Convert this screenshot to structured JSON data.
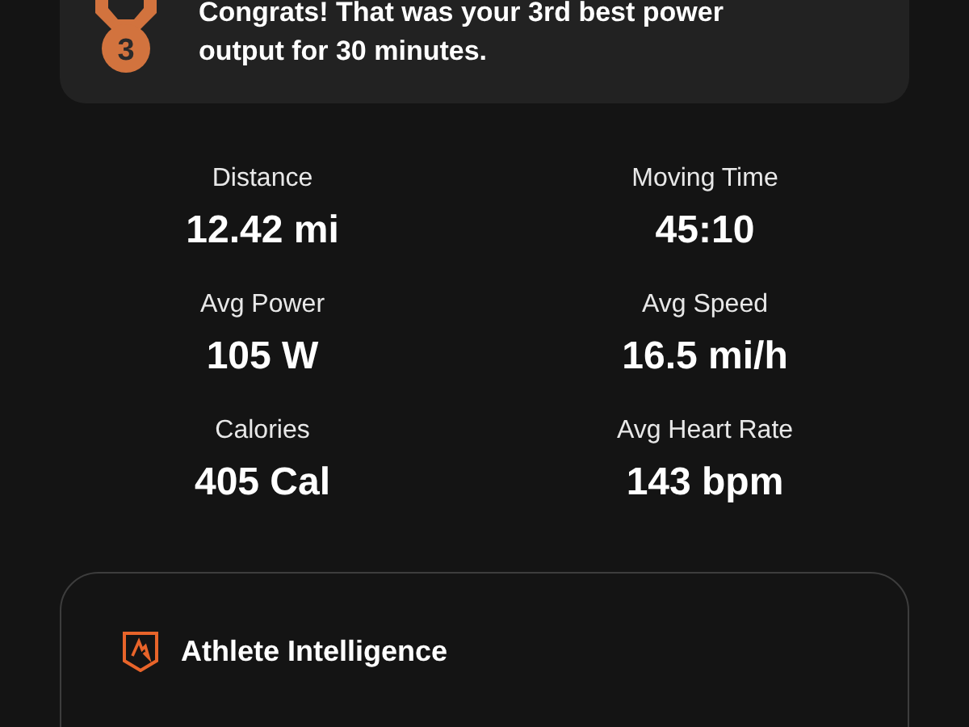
{
  "achievement": {
    "message": "Congrats! That was your 3rd best power output for 30 minutes.",
    "rank": "3"
  },
  "stats": [
    {
      "label": "Distance",
      "value": "12.42 mi"
    },
    {
      "label": "Moving Time",
      "value": "45:10"
    },
    {
      "label": "Avg Power",
      "value": "105 W"
    },
    {
      "label": "Avg Speed",
      "value": "16.5 mi/h"
    },
    {
      "label": "Calories",
      "value": "405 Cal"
    },
    {
      "label": "Avg Heart Rate",
      "value": "143 bpm"
    }
  ],
  "athlete_intelligence": {
    "title": "Athlete Intelligence"
  }
}
